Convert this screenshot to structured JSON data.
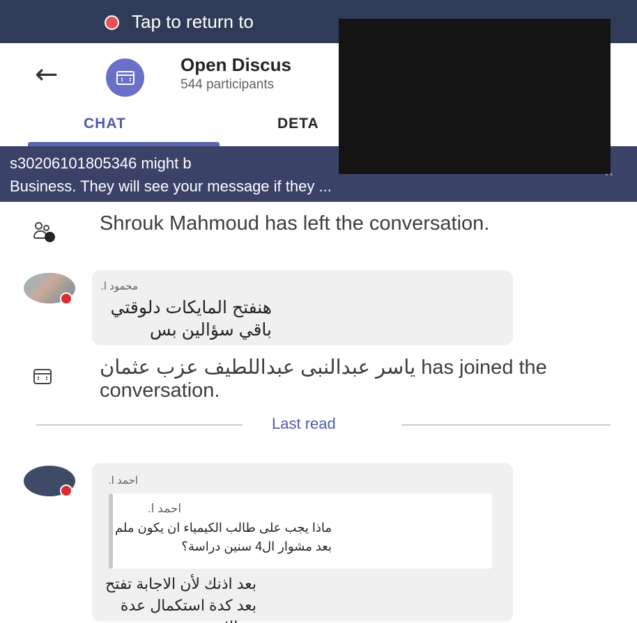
{
  "call_banner": {
    "text": "Tap to return to"
  },
  "header": {
    "back_icon": "arrow-left-icon",
    "avatar_icon": "meeting-calendar-icon",
    "title": "Open Discus",
    "subtitle": "544 participants"
  },
  "tabs": [
    {
      "label": "CHAT",
      "active": true
    },
    {
      "label": "DETA",
      "active": false
    }
  ],
  "notice": {
    "line1": "s30206101805346 might b",
    "line2": "Business. They will see your message if they ...",
    "close_icon": "chevron-up-icon"
  },
  "messages": [
    {
      "type": "system",
      "icon": "person-left-icon",
      "text": "Shrouk Mahmoud has left the conversation."
    },
    {
      "type": "message",
      "sender": "محمود ا.",
      "text": "هنفتح المايكات دلوقتي باقي سؤالين بس"
    },
    {
      "type": "system",
      "icon": "meeting-calendar-icon",
      "text": "ياسر عبدالنبى عبداللطيف عزب عثمان has joined the conversation."
    },
    {
      "type": "divider",
      "label": "Last read"
    },
    {
      "type": "message",
      "sender": "احمد ا.",
      "quote": {
        "sender": "احمد ا.",
        "text": "ماذا يجب على طالب الكيمياء ان يكون ملم بعد مشوار ال4 سنين دراسة؟"
      },
      "text": "بعد اذنك لأن الاجابة تفتح بعد كدة استكمال عدة مجالات"
    }
  ],
  "colors": {
    "banner": "#2f3b57",
    "notice": "#3a4268",
    "accent": "#4f5aa8",
    "bubble": "#f0f0f0",
    "presence_busy": "#d92c2c"
  }
}
